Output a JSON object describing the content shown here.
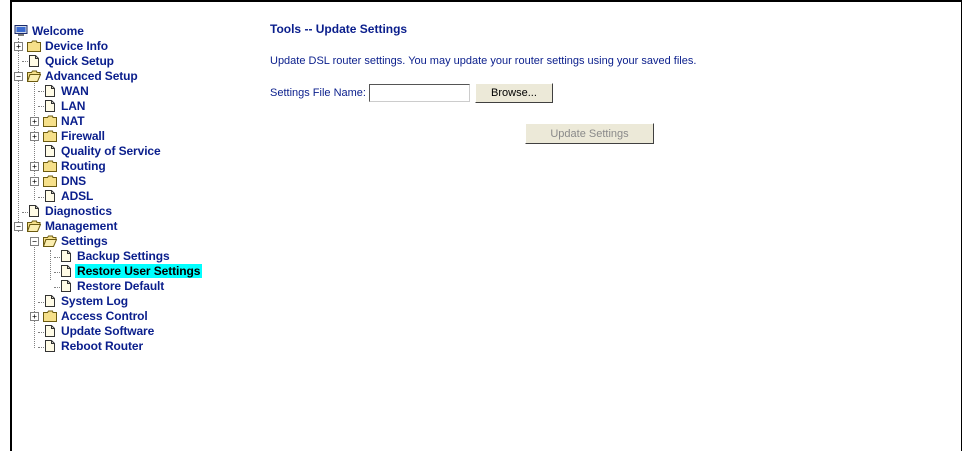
{
  "tree": {
    "welcome": "Welcome",
    "device_info": "Device Info",
    "quick_setup": "Quick Setup",
    "advanced_setup": "Advanced Setup",
    "wan": "WAN",
    "lan": "LAN",
    "nat": "NAT",
    "firewall": "Firewall",
    "qos": "Quality of Service",
    "routing": "Routing",
    "dns": "DNS",
    "adsl": "ADSL",
    "diagnostics": "Diagnostics",
    "management": "Management",
    "settings": "Settings",
    "backup_settings": "Backup Settings",
    "restore_user_settings": "Restore User Settings",
    "restore_default": "Restore Default",
    "system_log": "System Log",
    "access_control": "Access Control",
    "update_software": "Update Software",
    "reboot_router": "Reboot Router"
  },
  "main": {
    "title": "Tools -- Update Settings",
    "description": "Update DSL router settings. You may update your router settings using your saved files.",
    "file_label": "Settings File Name:",
    "file_value": "",
    "browse_label": "Browse...",
    "update_label": "Update Settings"
  },
  "colors": {
    "link": "#0a1e8c",
    "selected_bg": "#00ffff",
    "folder": "#f6e08a"
  },
  "icons": {
    "welcome": "computer-icon",
    "folder": "folder-icon",
    "page": "page-icon",
    "expand": "plus-box-icon",
    "collapse": "minus-box-icon"
  }
}
